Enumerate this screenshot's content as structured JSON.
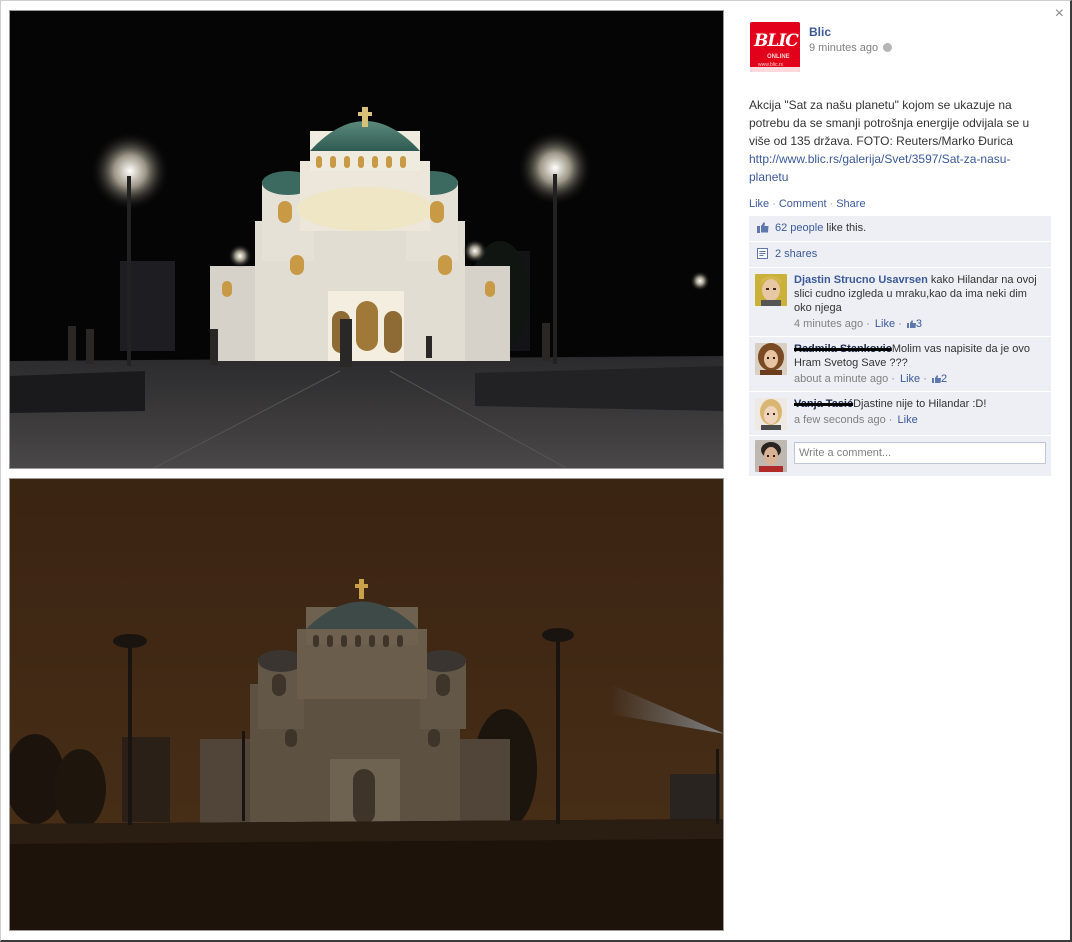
{
  "close_glyph": "×",
  "page": {
    "name": "Blic",
    "logo_text": "BLIC",
    "logo_sub": "ONLINE",
    "logo_url": "www.blic.rs",
    "time": "9 minutes ago",
    "privacy_icon": "globe-icon"
  },
  "post": {
    "text": "Akcija \"Sat za našu planetu\" kojom se ukazuje na potrebu da se smanji potrošnja energije odvijala se u više od 135 država. FOTO: Reuters/Marko Đurica",
    "link": "http://www.blic.rs/galerija/Svet/3597/Sat-za-nasu-planetu"
  },
  "actions": {
    "like": "Like",
    "comment": "Comment",
    "share": "Share",
    "separator": "·"
  },
  "likes": {
    "count_link": "62 people",
    "suffix": " like this."
  },
  "shares": {
    "label": "2 shares"
  },
  "comments": [
    {
      "author": "Djastin Strucno Usavrsen",
      "text": " kako Hilandar na ovoj slici cudno izgleda u mraku,kao da ima neki dim oko njega",
      "time": "4 minutes ago",
      "like_label": "Like",
      "likes": "3"
    },
    {
      "author": "Radmila Stankovic",
      "text": "Molim vas napisite da je ovo Hram Svetog Save ???",
      "time": "about a minute ago",
      "like_label": "Like",
      "likes": "2"
    },
    {
      "author": "Vanja Tasić",
      "text": "Djastine nije to Hilandar :D!",
      "time": "a few seconds ago",
      "like_label": "Like"
    }
  ],
  "composer": {
    "placeholder": "Write a comment..."
  },
  "colors": {
    "link": "#3b5998",
    "ufi_bg": "#edeff4",
    "brand_red": "#e3001b"
  }
}
